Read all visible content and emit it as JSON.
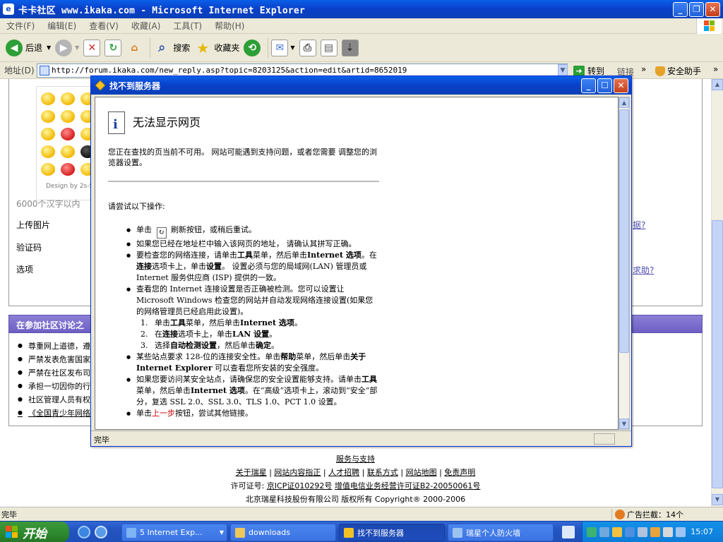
{
  "window": {
    "title": "卡卡社区 www.ikaka.com - Microsoft Internet Explorer",
    "icon_label": "e"
  },
  "menu": [
    "文件(F)",
    "编辑(E)",
    "查看(V)",
    "收藏(A)",
    "工具(T)",
    "帮助(H)"
  ],
  "toolbar": {
    "back": "后退",
    "search": "搜索",
    "favorites": "收藏夹"
  },
  "address": {
    "label": "地址(D)",
    "url": "http://forum.ikaka.com/new_reply.asp?topic=8203125&action=edit&artid=8652019",
    "go": "转到",
    "links": "链接",
    "links_more": "»",
    "security_helper": "安全助手",
    "more": "»"
  },
  "page": {
    "design_by": "Design by 2s-Sp",
    "char_limit": "6000个汉字以内",
    "upload_label": "上传图片",
    "captcha_label": "验证码",
    "options_label": "选项",
    "side_link_1": "据?",
    "side_link_2": "求助?",
    "rules_header": "在参加社区讨论之",
    "rules": [
      "尊重网上道德，遵",
      "严禁发表危害国家",
      "严禁在社区发布司",
      "承担一切因你的行",
      "社区管理人员有权",
      "《全国青少年网络"
    ],
    "footer": {
      "support": "服务与支持",
      "links": [
        "关于瑞星",
        "网站内容指正",
        "人才招聘",
        "联系方式",
        "网站地图",
        "免责声明"
      ],
      "separator": "|",
      "license_prefix": "许可证号:",
      "icp": "京ICP证010292号",
      "license": "增值电信业务经营许可证B2-20050061号",
      "company": "北京瑞星科技股份有限公司 版权所有 Copyright® 2000-2006"
    }
  },
  "status": {
    "text": "完毕",
    "ad_block": "广告拦截：14个"
  },
  "dialog": {
    "title": "找不到服务器",
    "heading": "无法显示网页",
    "description": "您正在查找的页当前不可用。 网站可能遇到支持问题，或者您需要 调整您的浏览器设置。",
    "try_label": "请尝试以下操作:",
    "b1_pre": "单击",
    "b1_post": "刷新按钮，或稍后重试。",
    "b2": "如果您已经在地址栏中输入该网页的地址， 请确认其拼写正确。",
    "b3_a": "要检查您的网络连接，请单击",
    "b3_b": "工具",
    "b3_c": "菜单，然后单击",
    "b3_d": "Internet 选项",
    "b3_e": "。在",
    "b3_f": "连接",
    "b3_g": "选项卡上，单击",
    "b3_h": "设置",
    "b3_i": "。 设置必须与您的局域网(LAN) 管理员或 Internet 服务供应商 (ISP) 提供的一致。",
    "b4": "查看您的 Internet 连接设置是否正确被检测。您可以设置让 Microsoft Windows 检查您的网站并自动发现网络连接设置(如果您的网络管理员已经启用此设置)。",
    "s1_num": "1.",
    "s1_a": "单击",
    "s1_b": "工具",
    "s1_c": "菜单，然后单击",
    "s1_d": "Internet 选项",
    "s1_e": "。",
    "s2_num": "2.",
    "s2_a": "在",
    "s2_b": "连接",
    "s2_c": "选项卡上，单击",
    "s2_d": "LAN 设置",
    "s2_e": "。",
    "s3_num": "3.",
    "s3_a": "选择",
    "s3_b": "自动检测设置",
    "s3_c": "，然后单击",
    "s3_d": "确定",
    "s3_e": "。",
    "b5_a": "某些站点要求 128-位的连接安全性。单击",
    "b5_b": "帮助",
    "b5_c": "菜单，然后单击",
    "b5_d": "关于 Internet Explorer",
    "b5_e": " 可以查看您所安装的安全强度。",
    "b6_a": "如果您要访问某安全站点，请确保您的安全设置能够支持。请单击",
    "b6_b": "工具",
    "b6_c": "菜单，然后单击",
    "b6_d": "Internet 选项",
    "b6_e": "。在“高级”选项卡上，滚动到“安全”部分，复选 SSL 2.0、SSL 3.0、TLS 1.0、PCT 1.0 设置。",
    "b7_a": "单击",
    "b7_b": "上一步",
    "b7_c": "按钮，尝试其他链接。",
    "status": "完毕"
  },
  "taskbar": {
    "start": "开始",
    "tasks": [
      "5 Internet Exp...",
      "downloads",
      "找不到服务器",
      "瑞星个人防火墙"
    ],
    "clock": "15:07"
  },
  "colors": {
    "xp_blue": "#0A3FC8",
    "start_green": "#2E8B2E",
    "rules_header": "#6E5FC4"
  }
}
